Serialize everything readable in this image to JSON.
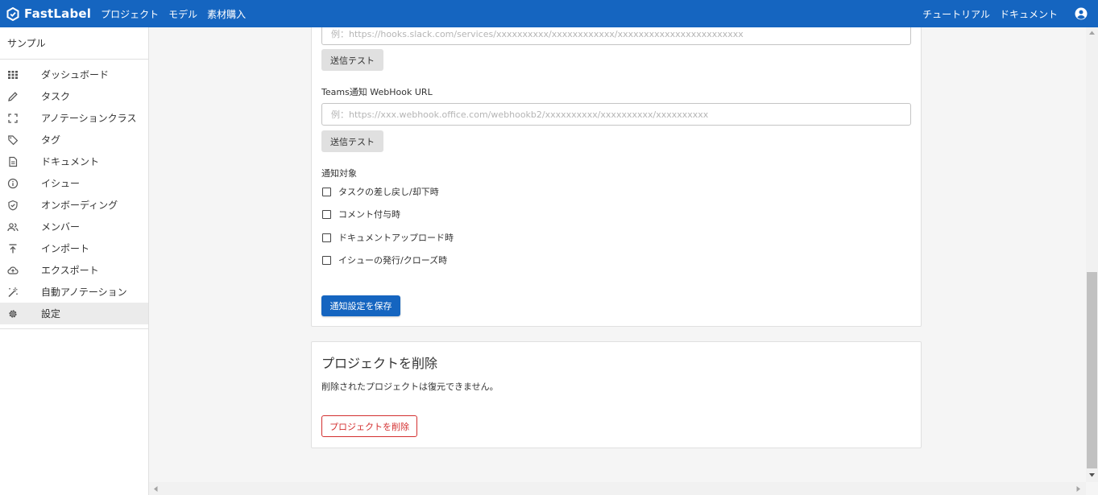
{
  "header": {
    "logo_text": "FastLabel",
    "nav": [
      "プロジェクト",
      "モデル",
      "素材購入"
    ],
    "right_links": [
      "チュートリアル",
      "ドキュメント"
    ],
    "colors": {
      "primary": "#1565c0"
    }
  },
  "sidebar": {
    "project_name": "サンプル",
    "items": [
      {
        "label": "ダッシュボード",
        "icon": "dashboard-icon"
      },
      {
        "label": "タスク",
        "icon": "pencil-icon"
      },
      {
        "label": "アノテーションクラス",
        "icon": "bounding-box-icon"
      },
      {
        "label": "タグ",
        "icon": "tag-icon"
      },
      {
        "label": "ドキュメント",
        "icon": "document-icon"
      },
      {
        "label": "イシュー",
        "icon": "info-icon"
      },
      {
        "label": "オンボーディング",
        "icon": "shield-check-icon"
      },
      {
        "label": "メンバー",
        "icon": "people-icon"
      },
      {
        "label": "インポート",
        "icon": "upload-icon"
      },
      {
        "label": "エクスポート",
        "icon": "cloud-upload-icon"
      },
      {
        "label": "自動アノテーション",
        "icon": "magic-wand-icon"
      },
      {
        "label": "設定",
        "icon": "gear-icon"
      }
    ]
  },
  "notification_card": {
    "slack_placeholder": "例：https://hooks.slack.com/services/xxxxxxxxxx/xxxxxxxxxxxx/xxxxxxxxxxxxxxxxxxxxxxxx",
    "slack_test_label": "送信テスト",
    "teams_label": "Teams通知 WebHook URL",
    "teams_placeholder": "例：https://xxx.webhook.office.com/webhookb2/xxxxxxxxxx/xxxxxxxxxx/xxxxxxxxxx",
    "teams_test_label": "送信テスト",
    "targets_label": "通知対象",
    "targets": [
      {
        "label": "タスクの差し戻し/却下時",
        "checked": false
      },
      {
        "label": "コメント付与時",
        "checked": false
      },
      {
        "label": "ドキュメントアップロード時",
        "checked": false
      },
      {
        "label": "イシューの発行/クローズ時",
        "checked": false
      }
    ],
    "save_label": "通知設定を保存"
  },
  "delete_card": {
    "title": "プロジェクトを削除",
    "description": "削除されたプロジェクトは復元できません。",
    "delete_label": "プロジェクトを削除",
    "danger_color": "#d32f2f"
  }
}
